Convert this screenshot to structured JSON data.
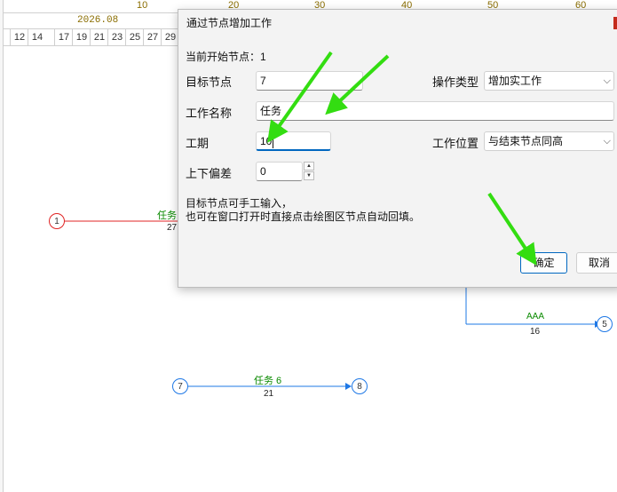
{
  "ruler": {
    "ticks": [
      "10",
      "20",
      "30",
      "40",
      "50",
      "60"
    ]
  },
  "timeline": {
    "month": "2026.08",
    "days": [
      "12",
      "14",
      "17",
      "19",
      "21",
      "23",
      "25",
      "27",
      "29"
    ]
  },
  "network": {
    "nodes": [
      "1",
      "5",
      "7",
      "8"
    ],
    "edges": [
      {
        "name": "任务",
        "duration": "27"
      },
      {
        "name": "AAA",
        "duration": "16"
      },
      {
        "name": "任务 6",
        "duration": "21"
      }
    ]
  },
  "dialog": {
    "title": "通过节点增加工作",
    "current_start_node": "当前开始节点：1",
    "labels": {
      "target_node": "目标节点",
      "op_type": "操作类型",
      "work_name": "工作名称",
      "duration": "工期",
      "work_position": "工作位置",
      "offset": "上下偏差"
    },
    "fields": {
      "target_node": "7",
      "op_type": "增加实工作",
      "work_name": "任务",
      "duration": "10",
      "work_position": "与结束节点同高",
      "offset": "0"
    },
    "hint_line1": "目标节点可手工输入，",
    "hint_line2": "也可在窗口打开时直接点击绘图区节点自动回填。",
    "buttons": {
      "ok": "确定",
      "cancel": "取消"
    }
  },
  "colors": {
    "arrow_green": "#33dd11",
    "accent": "#0067c0",
    "node_red": "#e02424",
    "node_blue": "#1e78e6"
  }
}
